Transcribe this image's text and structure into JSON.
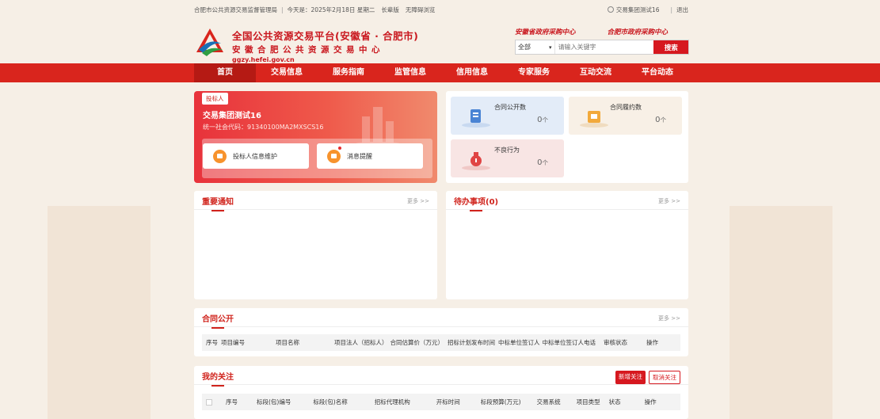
{
  "topbar": {
    "org": "合肥市公共资源交易监督管理局",
    "today": "今天是：2025年2月18日 星期二",
    "elder_mode": "长辈版",
    "accessible": "无障碍浏览",
    "user": "交易集团测试16",
    "logout": "退出"
  },
  "header": {
    "title": "全国公共资源交易平台(安徽省 · 合肥市)",
    "subtitle": "安徽合肥公共资源交易中心",
    "url": "ggzy.hefei.gov.cn",
    "org_link_1": "安徽省政府采购中心",
    "org_link_2": "合肥市政府采购中心",
    "search": {
      "selected": "全部",
      "placeholder": "请输入关键字",
      "button": "搜索"
    }
  },
  "nav": {
    "items": [
      {
        "label": "首页"
      },
      {
        "label": "交易信息"
      },
      {
        "label": "服务指南"
      },
      {
        "label": "监管信息"
      },
      {
        "label": "信用信息"
      },
      {
        "label": "专家服务"
      },
      {
        "label": "互动交流"
      },
      {
        "label": "平台动态"
      }
    ]
  },
  "profile": {
    "tag": "投标人",
    "company": "交易集团测试16",
    "credit_code": "统一社会代码：91340100MA2MXSCS16",
    "btn_info": "投标人信息维护",
    "btn_msg": "消息提醒"
  },
  "stats": {
    "contract_public": {
      "label": "合同公开数",
      "value": "0",
      "unit": "个"
    },
    "contract_perform": {
      "label": "合同履约数",
      "value": "0",
      "unit": "个"
    },
    "bad_behavior": {
      "label": "不良行为",
      "value": "0",
      "unit": "个"
    }
  },
  "notice": {
    "title": "重要通知",
    "more": "更多 >>"
  },
  "todo": {
    "title": "待办事项(0)",
    "more": "更多 >>"
  },
  "contract": {
    "title": "合同公开",
    "more": "更多 >>",
    "columns": [
      "序号",
      "项目编号",
      "项目名称",
      "项目法人（招标人）",
      "合同估算价（万元）",
      "招标计划发布时间",
      "中标单位签订人",
      "中标单位签订人电话",
      "审核状态",
      "操作"
    ]
  },
  "follow": {
    "title": "我的关注",
    "add": "新增关注",
    "cancel": "取消关注",
    "columns": [
      "序号",
      "标段(包)编号",
      "标段(包)名称",
      "招标代理机构",
      "开标时间",
      "标段预算(万元)",
      "交易系统",
      "项目类型",
      "状态",
      "操作"
    ]
  },
  "colors": {
    "brand_red": "#d9251d",
    "nav_active": "#b51a14",
    "background": "#f6efe6"
  }
}
